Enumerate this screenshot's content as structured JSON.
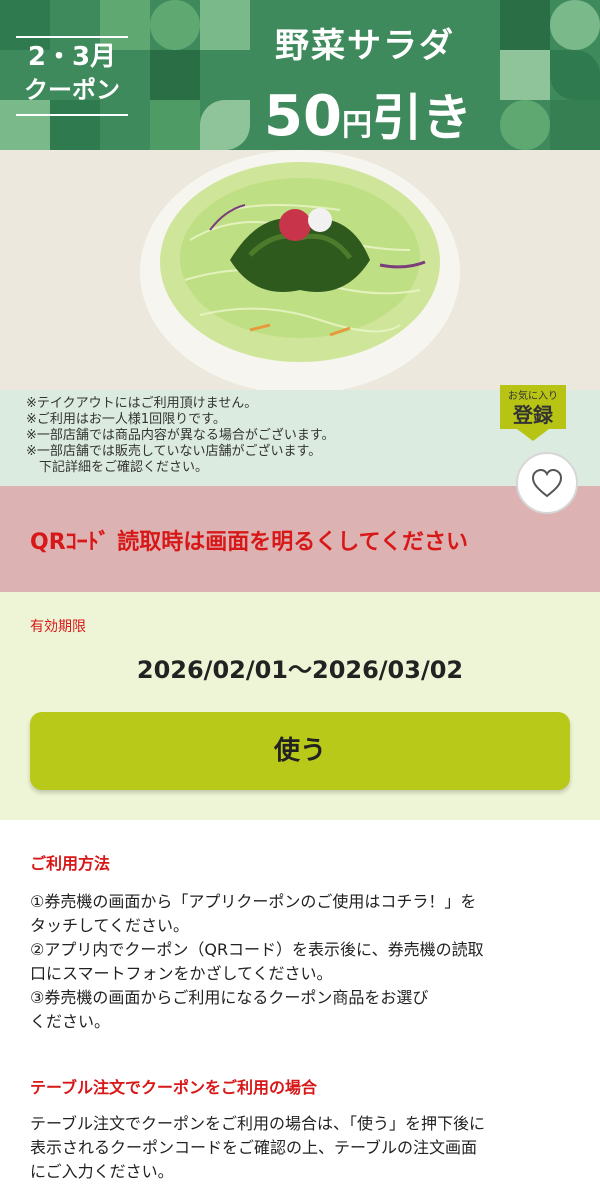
{
  "banner": {
    "period_line1": "2・3月",
    "period_line2": "クーポン",
    "title": "野菜サラダ",
    "price_num": "50",
    "price_yen": "円",
    "price_suffix": "引き"
  },
  "notes": [
    "※テイクアウトにはご利用頂けません。",
    "※ご利用はお一人様1回限りです。",
    "※一部店舗では商品内容が異なる場合がございます。",
    "※一部店舗では販売していない店舗がございます。",
    "　下記詳細をご確認ください。"
  ],
  "favorite": {
    "small": "お気に入り",
    "large": "登録",
    "icon": "heart-icon"
  },
  "qr_notice": "QRｺｰﾄﾞ 読取時は画面を明るくしてください",
  "validity": {
    "label": "有効期限",
    "range": "2026/02/01～2026/03/02"
  },
  "use_button": "使う",
  "how_to": {
    "title": "ご利用方法",
    "lines": [
      "①券売機の画面から「アプリクーポンのご使用はコチラ！」を",
      "タッチしてください。",
      "②アプリ内でクーポン（QRコード）を表示後に、券売機の読取",
      "口にスマートフォンをかざしてください。",
      "③券売機の画面からご利用になるクーポン商品をお選び",
      "ください。"
    ]
  },
  "table_order": {
    "title": "テーブル注文でクーポンをご利用の場合",
    "lines": [
      "テーブル注文でクーポンをご利用の場合は、「使う」を押下後に",
      "表示されるクーポンコードをご確認の上、テーブルの注文画面",
      "にご入力ください。"
    ]
  },
  "colors": {
    "banner_green": "#3f8a5c",
    "accent_red": "#d81818",
    "button_lime": "#b9c91a",
    "qr_band": "#ddb2b2"
  }
}
